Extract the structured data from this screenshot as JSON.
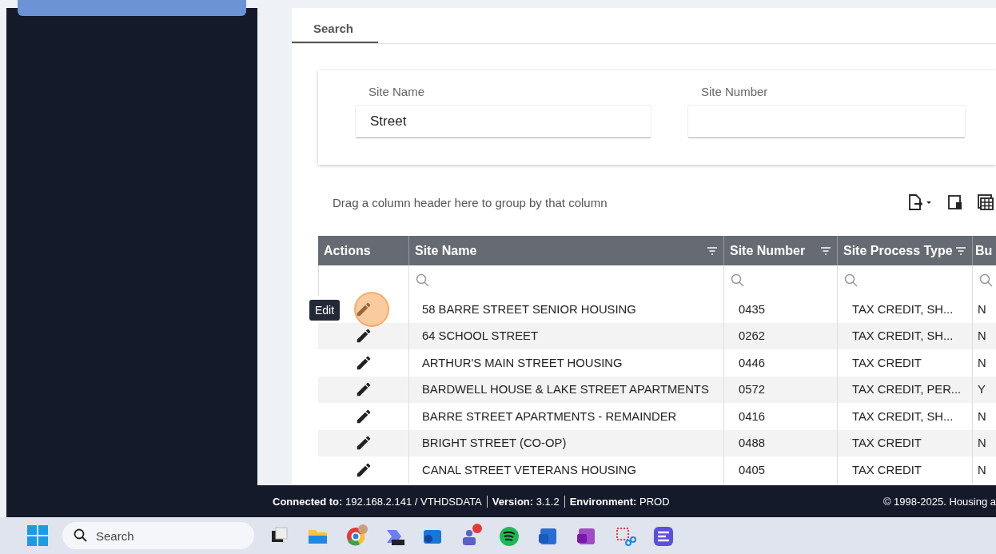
{
  "tabs": [
    {
      "label": "Search",
      "selected": true
    }
  ],
  "search_form": {
    "fields": [
      {
        "label": "Site Name",
        "value": "Street"
      },
      {
        "label": "Site Number"
      }
    ]
  },
  "grid": {
    "group_hint": "Drag a column header here to group by that column",
    "columns": [
      "Actions",
      "Site Name",
      "Site Number",
      "Site Process Type",
      "Bu"
    ],
    "rows": [
      {
        "site_name": "58 BARRE STREET SENIOR HOUSING",
        "site_number": "0435",
        "process_type": "TAX CREDIT, SH...",
        "column_5": "N"
      },
      {
        "site_name": "64 SCHOOL STREET",
        "site_number": "0262",
        "process_type": "TAX CREDIT, SH...",
        "column_5": "N"
      },
      {
        "site_name": "ARTHUR'S MAIN STREET HOUSING",
        "site_number": "0446",
        "process_type": "TAX CREDIT",
        "column_5": "N"
      },
      {
        "site_name": "BARDWELL HOUSE & LAKE STREET APARTMENTS",
        "site_number": "0572",
        "process_type": "TAX CREDIT, PER...",
        "column_5": "Y"
      },
      {
        "site_name": "BARRE STREET APARTMENTS - REMAINDER",
        "site_number": "0416",
        "process_type": "TAX CREDIT, SH...",
        "column_5": "N"
      },
      {
        "site_name": "BRIGHT STREET (CO-OP)",
        "site_number": "0488",
        "process_type": "TAX CREDIT",
        "column_5": "N"
      },
      {
        "site_name": "CANAL STREET VETERANS HOUSING",
        "site_number": "0405",
        "process_type": "TAX CREDIT",
        "column_5": "N"
      }
    ],
    "tooltip": "Edit"
  },
  "status_bar": {
    "items": [
      {
        "label": "Connected to:",
        "value": "192.168.2.141 / VTHDSDATA"
      },
      {
        "label": "Version:",
        "value": "3.1.2"
      },
      {
        "label": "Environment:",
        "value": "PROD"
      }
    ],
    "copyright": "© 1998-2025. Housing a"
  },
  "taskbar": {
    "search_placeholder": "Search"
  }
}
